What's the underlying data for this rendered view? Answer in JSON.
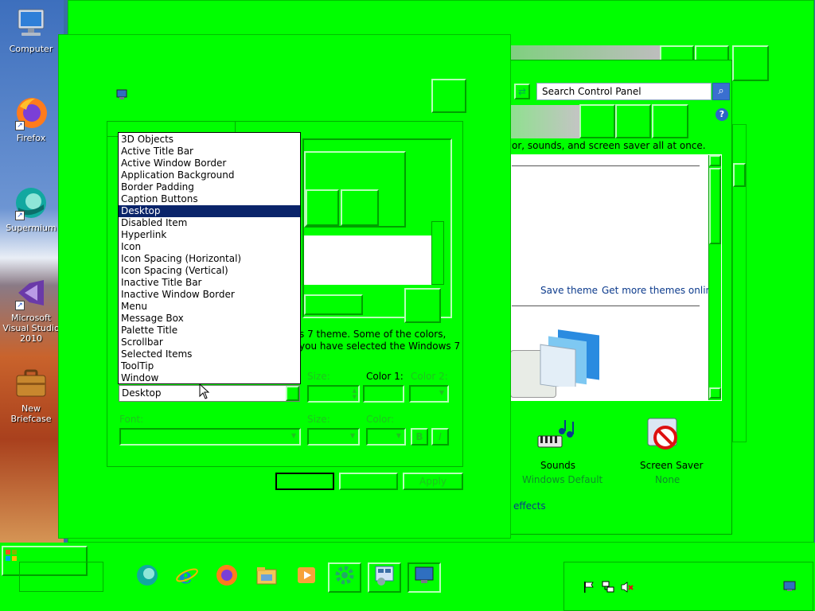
{
  "desktop": {
    "icons": [
      {
        "label": "Computer",
        "icon": "computer-icon"
      },
      {
        "label": "Firefox",
        "icon": "firefox-icon"
      },
      {
        "label": "Supermium",
        "icon": "supermium-icon"
      },
      {
        "label": "Microsoft Visual Studio 2010",
        "icon": "visual-studio-icon"
      },
      {
        "label": "New Briefcase",
        "icon": "briefcase-icon"
      }
    ]
  },
  "control_panel": {
    "search_placeholder": "Search Control Panel",
    "description": "or, sounds, and screen saver all at once.",
    "save_theme": "Save theme",
    "get_more_themes": "Get more themes online",
    "sounds_label": "Sounds",
    "sounds_value": "Windows Default",
    "screensaver_label": "Screen Saver",
    "screensaver_value": "None",
    "effects_text": "effects"
  },
  "appearance_dialog": {
    "body_text_line1": "s 7 theme.  Some of the colors,",
    "body_text_line2": "you have selected the Windows 7",
    "item_list": [
      "3D Objects",
      "Active Title Bar",
      "Active Window Border",
      "Application Background",
      "Border Padding",
      "Caption Buttons",
      "Desktop",
      "Disabled Item",
      "Hyperlink",
      "Icon",
      "Icon Spacing (Horizontal)",
      "Icon Spacing (Vertical)",
      "Inactive Title Bar",
      "Inactive Window Border",
      "Menu",
      "Message Box",
      "Palette Title",
      "Scrollbar",
      "Selected Items",
      "ToolTip",
      "Window"
    ],
    "selected_item": "Desktop",
    "item_combo_value": "Desktop",
    "size_label": "Size:",
    "color1_label": "Color 1:",
    "color2_label": "Color 2:",
    "font_label": "Font:",
    "font_size_label": "Size:",
    "font_color_label": "Color:",
    "bold_label": "B",
    "italic_label": "I",
    "apply_label": "Apply"
  },
  "taskbar": {
    "apps": [
      {
        "icon": "supermium-icon"
      },
      {
        "icon": "internet-explorer-icon"
      },
      {
        "icon": "firefox-icon"
      },
      {
        "icon": "file-explorer-icon"
      },
      {
        "icon": "media-player-icon"
      },
      {
        "icon": "settings-icon"
      },
      {
        "icon": "control-panel-icon"
      },
      {
        "icon": "display-settings-icon"
      }
    ],
    "tray_icons": [
      "flag-icon",
      "network-icon",
      "volume-muted-icon"
    ],
    "show_desktop_icon": "show-desktop-icon"
  },
  "colors": {
    "theme_green": "#00ff00",
    "selection": "#0a246a",
    "link": "#0b3a8c"
  }
}
